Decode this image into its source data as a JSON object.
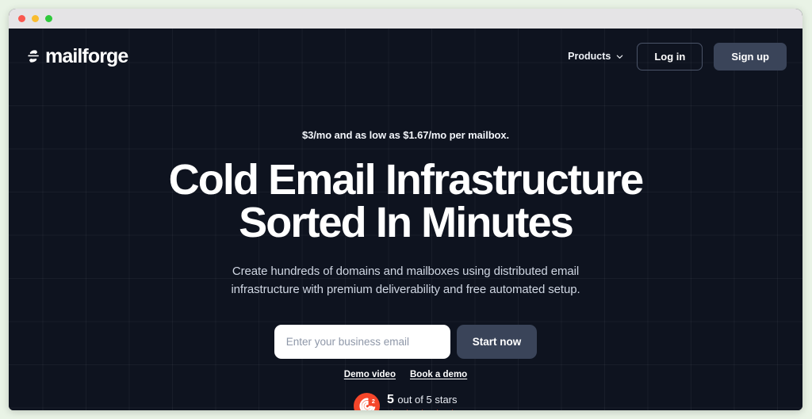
{
  "window": {
    "traffic_lights": [
      "close",
      "minimize",
      "maximize"
    ]
  },
  "navbar": {
    "brand_name": "mailforge",
    "brand_mark_icon": "mailforge-logo-icon",
    "products_label": "Products",
    "chevron_icon": "chevron-down-icon",
    "login_label": "Log in",
    "signup_label": "Sign up"
  },
  "hero": {
    "eyebrow": "$3/mo and as low as $1.67/mo per mailbox.",
    "headline_line1": "Cold Email Infrastructure",
    "headline_line2": "Sorted In Minutes",
    "subheadline_line1": "Create hundreds of domains and mailboxes using distributed email",
    "subheadline_line2": "infrastructure with premium deliverability and free automated setup."
  },
  "form": {
    "email_placeholder": "Enter your business email",
    "email_value": "",
    "submit_label": "Start now"
  },
  "secondary_links": [
    {
      "label": "Demo video"
    },
    {
      "label": "Book a demo"
    }
  ],
  "rating": {
    "logo_icon": "g2-logo-icon",
    "score": "5",
    "caption": "out of 5 stars",
    "star_count": 5,
    "star_icon": "star-icon"
  },
  "colors": {
    "page_background": "#e9f3e6",
    "titlebar": "#e5e4e6",
    "hero_background": "#0e131f",
    "button_slate": "#3a4459",
    "g2_orange": "#f5462a",
    "star_orange": "#f5462a",
    "text_primary": "#ffffff",
    "text_muted": "#cfd6e2"
  }
}
